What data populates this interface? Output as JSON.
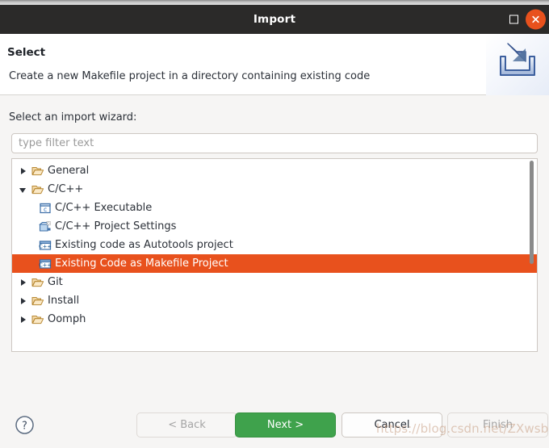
{
  "window": {
    "title": "Import",
    "maximize_label": "maximize",
    "close_label": "close"
  },
  "header": {
    "title": "Select",
    "description": "Create a new Makefile project in a directory containing existing code",
    "icon": "import-wizard-icon"
  },
  "body": {
    "section_label": "Select an import wizard:",
    "filter": {
      "value": "",
      "placeholder": "type filter text"
    }
  },
  "tree": {
    "items": [
      {
        "label": "General",
        "icon": "folder-icon",
        "level": 0,
        "state": "collapsed",
        "selected": false
      },
      {
        "label": "C/C++",
        "icon": "folder-icon",
        "level": 0,
        "state": "expanded",
        "selected": false
      },
      {
        "label": "C/C++ Executable",
        "icon": "c-file-icon",
        "level": 1,
        "state": "leaf",
        "selected": false
      },
      {
        "label": "C/C++ Project Settings",
        "icon": "project-settings-icon",
        "level": 1,
        "state": "leaf",
        "selected": false
      },
      {
        "label": "Existing code as Autotools project",
        "icon": "cpp-project-icon",
        "level": 1,
        "state": "leaf",
        "selected": false
      },
      {
        "label": "Existing Code as Makefile Project",
        "icon": "cpp-project-icon",
        "level": 1,
        "state": "leaf",
        "selected": true
      },
      {
        "label": "Git",
        "icon": "folder-icon",
        "level": 0,
        "state": "collapsed",
        "selected": false
      },
      {
        "label": "Install",
        "icon": "folder-icon",
        "level": 0,
        "state": "collapsed",
        "selected": false
      },
      {
        "label": "Oomph",
        "icon": "folder-icon",
        "level": 0,
        "state": "collapsed",
        "selected": false
      }
    ],
    "selection_color": "#e8511d"
  },
  "footer": {
    "help_label": "?",
    "buttons": {
      "back": {
        "label": "< Back",
        "enabled": false
      },
      "next": {
        "label": "Next >",
        "enabled": true,
        "primary": true
      },
      "cancel": {
        "label": "Cancel",
        "enabled": true
      },
      "finish": {
        "label": "Finish",
        "enabled": false
      }
    }
  },
  "watermark": "https://blog.csdn.net/ZXwsbg"
}
